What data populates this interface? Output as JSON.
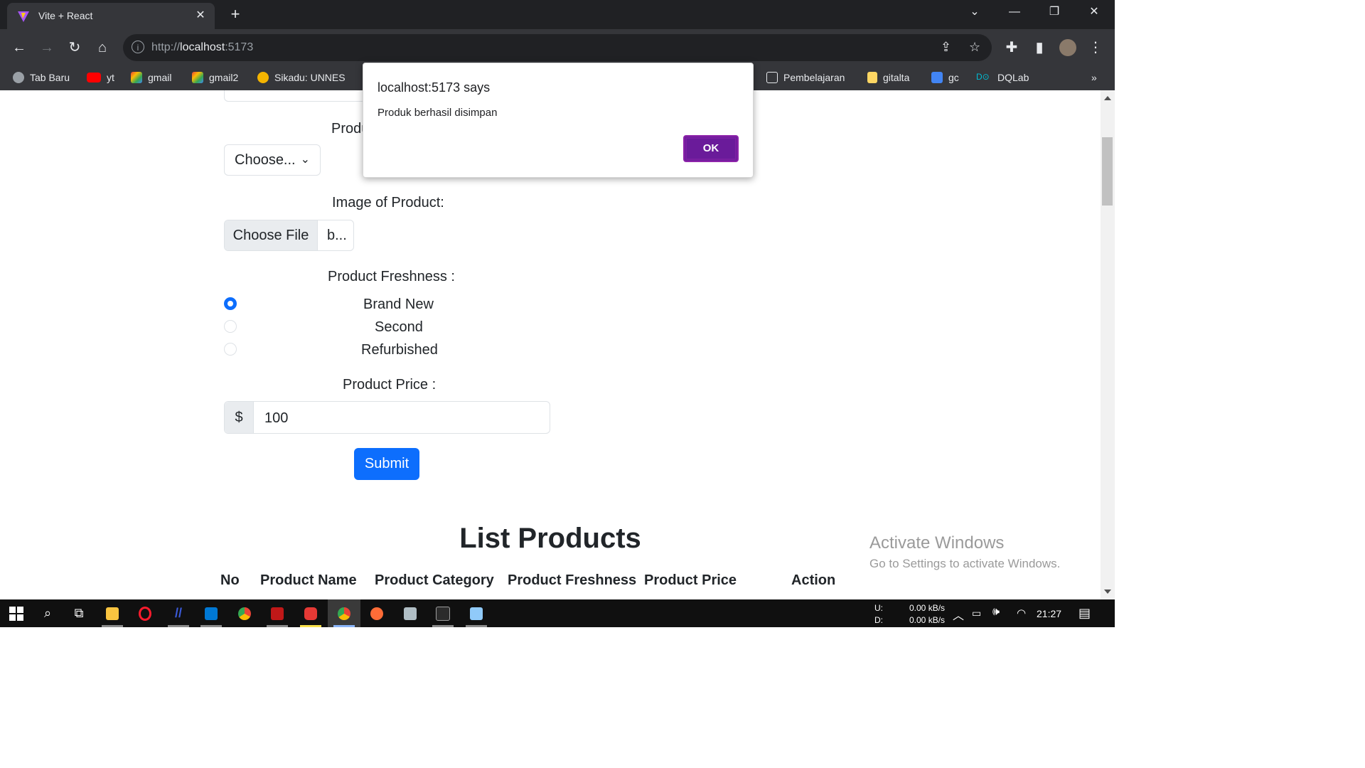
{
  "browser": {
    "tab_title": "Vite + React",
    "tab_close": "✕",
    "new_tab": "+",
    "url_scheme": "http://",
    "url_host": "localhost",
    "url_port": ":5173",
    "bookmarks": [
      {
        "label": "Tab Baru",
        "color": "#9aa0a6"
      },
      {
        "label": "yt",
        "color": "#ff0000"
      },
      {
        "label": "gmail",
        "color": "#ea4335"
      },
      {
        "label": "gmail2",
        "color": "#ea4335"
      },
      {
        "label": "Sikadu: UNNES",
        "color": "#f4b400"
      },
      {
        "label": "Pembelajaran",
        "color": "#ffffff"
      },
      {
        "label": "gitalta",
        "color": "#fdd663"
      },
      {
        "label": "gc",
        "color": "#4285f4"
      },
      {
        "label": "DQLab",
        "color": "#00bcd4"
      }
    ],
    "bookmarks_more": "»"
  },
  "form": {
    "category_label_partial": "Produ",
    "category_select_value": "Choose...",
    "image_label": "Image of Product:",
    "file_button": "Choose File",
    "file_name": "b...",
    "freshness_label": "Product Freshness :",
    "freshness_options": [
      {
        "label": "Brand New",
        "checked": true
      },
      {
        "label": "Second",
        "checked": false
      },
      {
        "label": "Refurbished",
        "checked": false
      }
    ],
    "price_label": "Product Price :",
    "price_prefix": "$",
    "price_value": "100",
    "submit_label": "Submit"
  },
  "list": {
    "title": "List Products",
    "headers": [
      "No",
      "Product Name",
      "Product Category",
      "Product Freshness",
      "Product Price",
      "Action"
    ]
  },
  "dialog": {
    "title": "localhost:5173 says",
    "message": "Produk berhasil disimpan",
    "ok_label": "OK"
  },
  "watermark": {
    "line1": "Activate Windows",
    "line2": "Go to Settings to activate Windows."
  },
  "taskbar": {
    "net_up_label": "U:",
    "net_down_label": "D:",
    "net_up": "0.00 kB/s",
    "net_down": "0.00 kB/s",
    "time": "21:27"
  },
  "colors": {
    "accent": "#0d6efd",
    "dialog_button": "#6a1b9a"
  }
}
